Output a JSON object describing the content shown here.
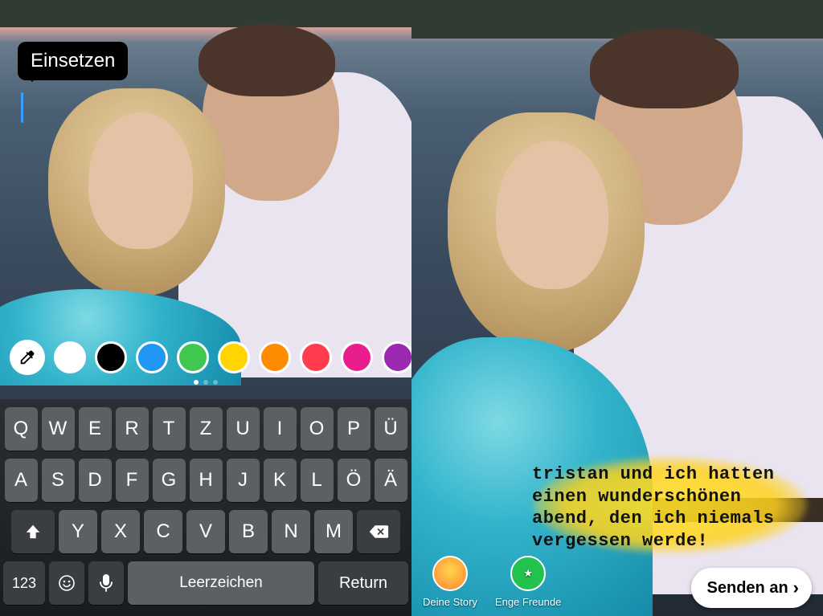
{
  "left": {
    "tooltip": "Einsetzen",
    "palette": {
      "colors": [
        "#ffffff",
        "#000000",
        "#2196f3",
        "#3fc750",
        "#ffd400",
        "#ff8c00",
        "#ff3b4e",
        "#e91e8c",
        "#9c27b0"
      ]
    },
    "keyboard": {
      "row1": [
        "Q",
        "W",
        "E",
        "R",
        "T",
        "Z",
        "U",
        "I",
        "O",
        "P",
        "Ü"
      ],
      "row2": [
        "A",
        "S",
        "D",
        "F",
        "G",
        "H",
        "J",
        "K",
        "L",
        "Ö",
        "Ä"
      ],
      "row3": [
        "Y",
        "X",
        "C",
        "V",
        "B",
        "N",
        "M"
      ],
      "numbers_key": "123",
      "space_key": "Leerzeichen",
      "return_key": "Return"
    }
  },
  "right": {
    "caption": "tristan und ich hatten\neinen wunderschönen\nabend, den ich niemals\nvergessen werde!",
    "share": {
      "your_story": "Deine Story",
      "close_friends": "Enge Freunde",
      "send": "Senden an"
    }
  }
}
